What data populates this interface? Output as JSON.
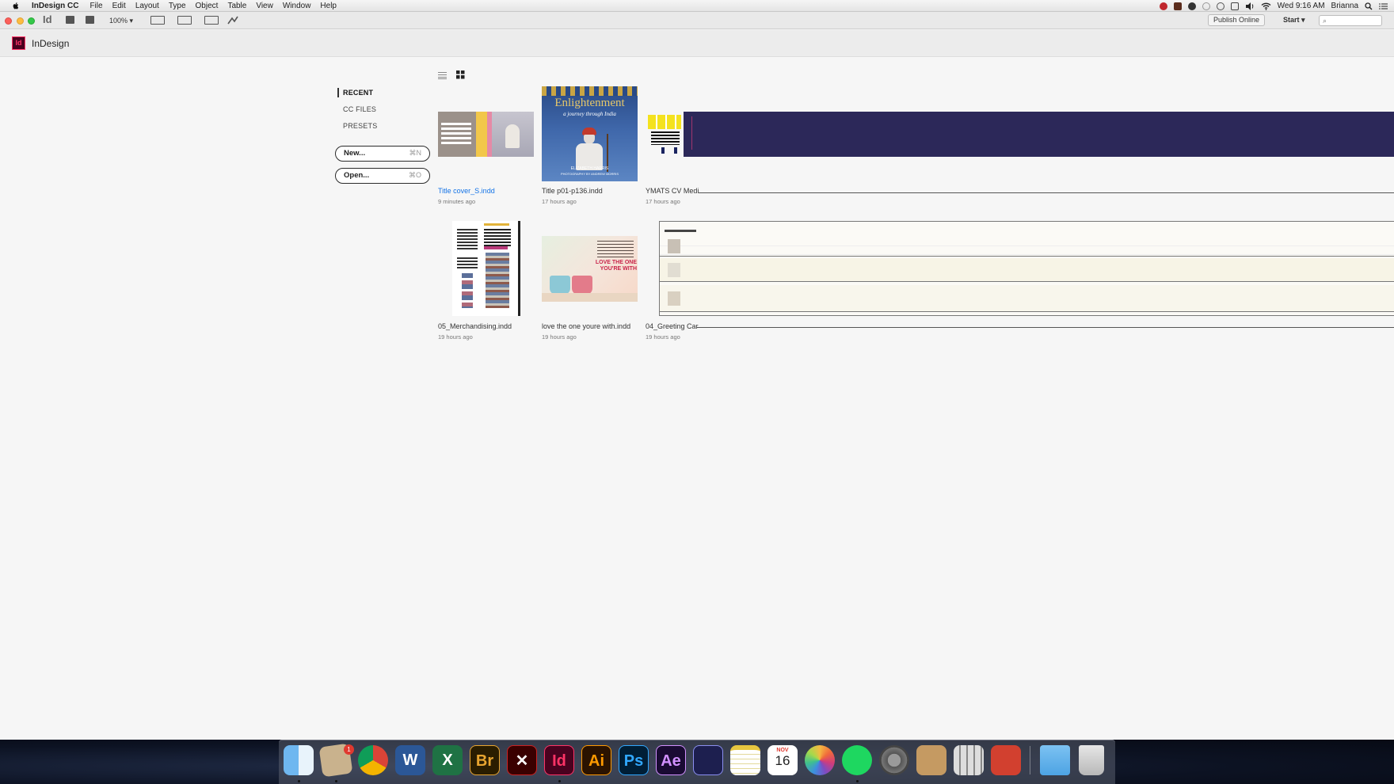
{
  "menubar": {
    "app_name": "InDesign CC",
    "menus": [
      "File",
      "Edit",
      "Layout",
      "Type",
      "Object",
      "Table",
      "View",
      "Window",
      "Help"
    ],
    "clock": "Wed 9:16 AM",
    "user": "Brianna"
  },
  "appbar": {
    "app_mark": "Id",
    "zoom": "100%",
    "publish_label": "Publish Online",
    "workspace_label": "Start",
    "search_placeholder": "⌕"
  },
  "workspace": {
    "logo": "Id",
    "title": "InDesign",
    "nav": {
      "recent": "RECENT",
      "cc_files": "CC FILES",
      "presets": "PRESETS"
    },
    "new_button": {
      "label": "New...",
      "shortcut": "⌘N"
    },
    "open_button": {
      "label": "Open...",
      "shortcut": "⌘O"
    }
  },
  "recent_files": [
    {
      "name": "Title cover_S.indd",
      "time": "9 minutes ago"
    },
    {
      "name": "Title p01-p136.indd",
      "time": "17 hours ago",
      "thumb_title": "Enlightenment",
      "thumb_subtitle": "a journey through India",
      "thumb_credit": "ELIZABETH HARRIS",
      "thumb_credit2": "PHOTOGRAPHY BY ANDREW MORRIS"
    },
    {
      "name": "YMATS CV Medi",
      "time": "17 hours ago"
    },
    {
      "name": "05_Merchandising.indd",
      "time": "19 hours ago"
    },
    {
      "name": "love the one youre with.indd",
      "time": "19 hours ago",
      "thumb_text": "LOVE THE ONE YOU'RE WITH"
    },
    {
      "name": "04_Greeting Car",
      "time": "19 hours ago"
    }
  ],
  "dock": {
    "badge": "1",
    "calendar_month": "NOV",
    "calendar_day": "16",
    "apps": [
      "Finder",
      "Mail",
      "Chrome",
      "Word",
      "Excel",
      "Bridge",
      "Acrobat",
      "InDesign",
      "Illustrator",
      "Photoshop",
      "After Effects",
      "Media Encoder",
      "Notes",
      "Calendar",
      "Photos",
      "Spotify",
      "System Preferences",
      "Contacts",
      "Calculator",
      "Remote Desktop",
      "Folder",
      "Trash"
    ],
    "labels": {
      "bridge": "Br",
      "indesign": "Id",
      "illustrator": "Ai",
      "photoshop": "Ps",
      "after_effects": "Ae"
    }
  },
  "colors": {
    "indesign_pink": "#ff3366",
    "indesign_bg": "#49021f",
    "link_blue": "#1473e6",
    "navy_thumb": "#2c2859"
  }
}
